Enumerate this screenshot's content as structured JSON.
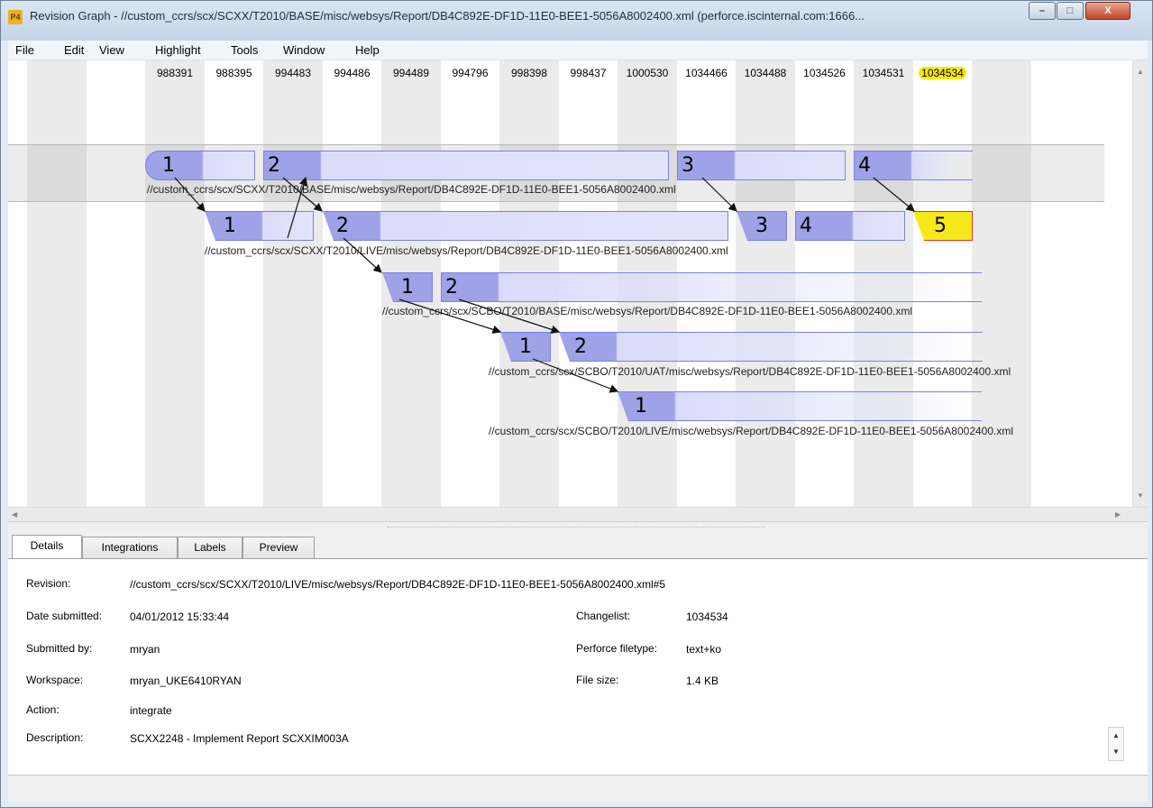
{
  "window": {
    "title": "Revision Graph - //custom_ccrs/scx/SCXX/T2010/BASE/misc/websys/Report/DB4C892E-DF1D-11E0-BEE1-5056A8002400.xml (perforce.iscinternal.com:1666...",
    "app_icon_label": "P4",
    "minimize_label": "–",
    "maximize_label": "□",
    "close_label": "X"
  },
  "menu": [
    "File",
    "Edit",
    "View",
    "Highlight",
    "Tools",
    "Window",
    "Help"
  ],
  "changelists": [
    "988391",
    "988395",
    "994483",
    "994486",
    "994489",
    "994796",
    "998398",
    "998437",
    "1000530",
    "1034466",
    "1034488",
    "1034526",
    "1034531",
    "1034534"
  ],
  "highlighted_changelist": "1034534",
  "branches": [
    {
      "path": "//custom_ccrs/scx/SCXX/T2010/BASE/misc/websys/Report/DB4C892E-DF1D-11E0-BEE1-5056A8002400.xml",
      "revisions": [
        "1",
        "2",
        "3",
        "4"
      ]
    },
    {
      "path": "//custom_ccrs/scx/SCXX/T2010/LIVE/misc/websys/Report/DB4C892E-DF1D-11E0-BEE1-5056A8002400.xml",
      "revisions": [
        "1",
        "2",
        "3",
        "4",
        "5"
      ]
    },
    {
      "path": "//custom_ccrs/scx/SCBO/T2010/BASE/misc/websys/Report/DB4C892E-DF1D-11E0-BEE1-5056A8002400.xml",
      "revisions": [
        "1",
        "2"
      ]
    },
    {
      "path": "//custom_ccrs/scx/SCBO/T2010/UAT/misc/websys/Report/DB4C892E-DF1D-11E0-BEE1-5056A8002400.xml",
      "revisions": [
        "1",
        "2"
      ]
    },
    {
      "path": "//custom_ccrs/scx/SCBO/T2010/LIVE/misc/websys/Report/DB4C892E-DF1D-11E0-BEE1-5056A8002400.xml",
      "revisions": [
        "1"
      ]
    }
  ],
  "tabs": [
    "Details",
    "Integrations",
    "Labels",
    "Preview"
  ],
  "active_tab": "Details",
  "details": {
    "revision_label": "Revision:",
    "revision_value": "//custom_ccrs/scx/SCXX/T2010/LIVE/misc/websys/Report/DB4C892E-DF1D-11E0-BEE1-5056A8002400.xml#5",
    "date_label": "Date submitted:",
    "date_value": "04/01/2012 15:33:44",
    "submitted_by_label": "Submitted by:",
    "submitted_by_value": "mryan",
    "workspace_label": "Workspace:",
    "workspace_value": "mryan_UKE6410RYAN",
    "action_label": "Action:",
    "action_value": "integrate",
    "description_label": "Description:",
    "description_value": "SCXX2248 - Implement Report SCXXIM003A",
    "changelist_label": "Changelist:",
    "changelist_value": "1034534",
    "filetype_label": "Perforce filetype:",
    "filetype_value": "text+ko",
    "filesize_label": "File size:",
    "filesize_value": "1.4 KB"
  },
  "colors": {
    "node_fill": "#9fa2e6",
    "node_border": "#7a80e8",
    "head_fill": "#f7e81a",
    "head_border": "#d63a1a",
    "highlight": "#f5ec00"
  }
}
